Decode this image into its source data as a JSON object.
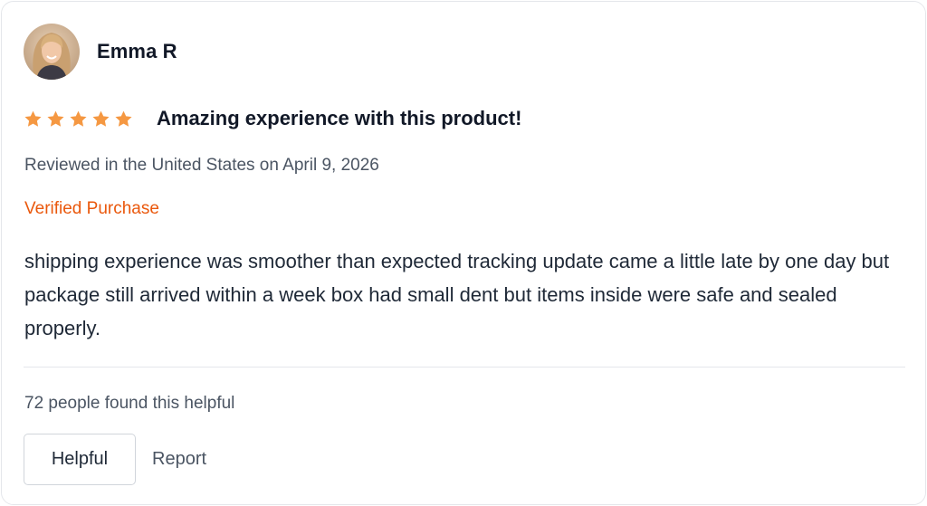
{
  "review": {
    "reviewer_name": "Emma R",
    "avatar_icon": "user-avatar",
    "rating": 5,
    "rating_max": 5,
    "star_color": "#f59842",
    "title": "Amazing experience with this product!",
    "meta": "Reviewed in the United States on April 9, 2026",
    "verified_label": "Verified Purchase",
    "verified_color": "#ea580c",
    "body": "shipping experience was smoother than expected tracking update came a little late by one day but package still arrived within a week box had small dent but items inside were safe and sealed properly.",
    "helpful_count_text": "72 people found this helpful",
    "actions": {
      "helpful_label": "Helpful",
      "report_label": "Report"
    }
  }
}
